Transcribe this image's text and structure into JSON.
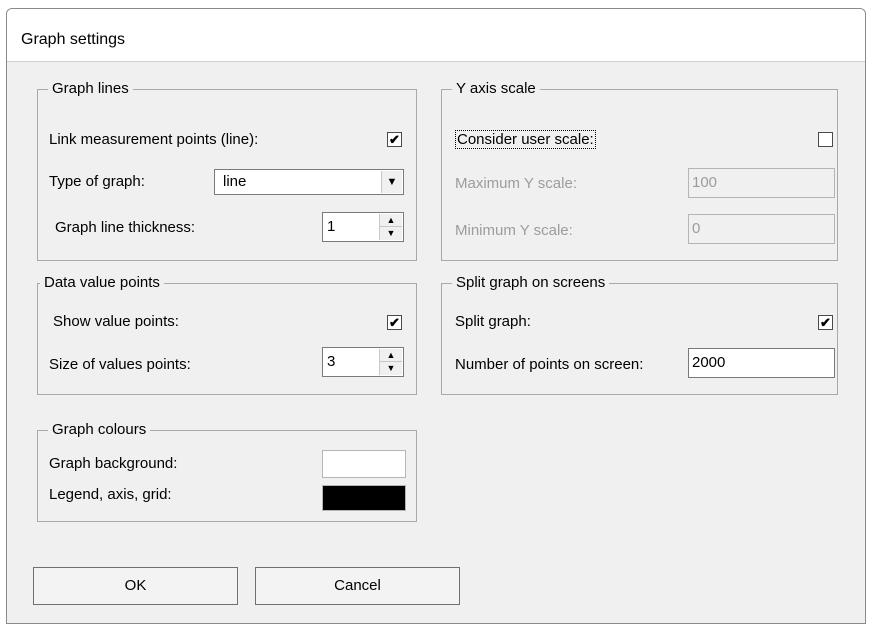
{
  "window": {
    "title": "Graph settings"
  },
  "graph_lines": {
    "legend": "Graph lines",
    "link_label": "Link measurement points (line):",
    "link_checked": "✔",
    "type_label": "Type of graph:",
    "type_value": "line",
    "thickness_label": "Graph line thickness:",
    "thickness_value": "1"
  },
  "data_value_points": {
    "legend": "Data value points",
    "show_label": "Show value points:",
    "show_checked": "✔",
    "size_label": "Size of values points:",
    "size_value": "3"
  },
  "graph_colours": {
    "legend": "Graph colours",
    "background_label": "Graph background:",
    "background_color": "#ffffff",
    "legend_axis_label": "Legend, axis, grid:",
    "legend_axis_color": "#000000"
  },
  "y_axis_scale": {
    "legend": "Y axis scale",
    "user_scale_label": "Consider user scale:",
    "user_scale_checked": "",
    "max_label": "Maximum Y scale:",
    "max_value": "100",
    "min_label": "Minimum Y scale:",
    "min_value": "0"
  },
  "split_graph": {
    "legend": "Split graph on screens",
    "split_label": "Split graph:",
    "split_checked": "✔",
    "points_label": "Number of points on screen:",
    "points_value": "2000"
  },
  "buttons": {
    "ok": "OK",
    "cancel": "Cancel"
  },
  "icons": {
    "dropdown": "chevron-down-icon",
    "spin_up": "arrow-up-icon",
    "spin_down": "arrow-down-icon"
  }
}
